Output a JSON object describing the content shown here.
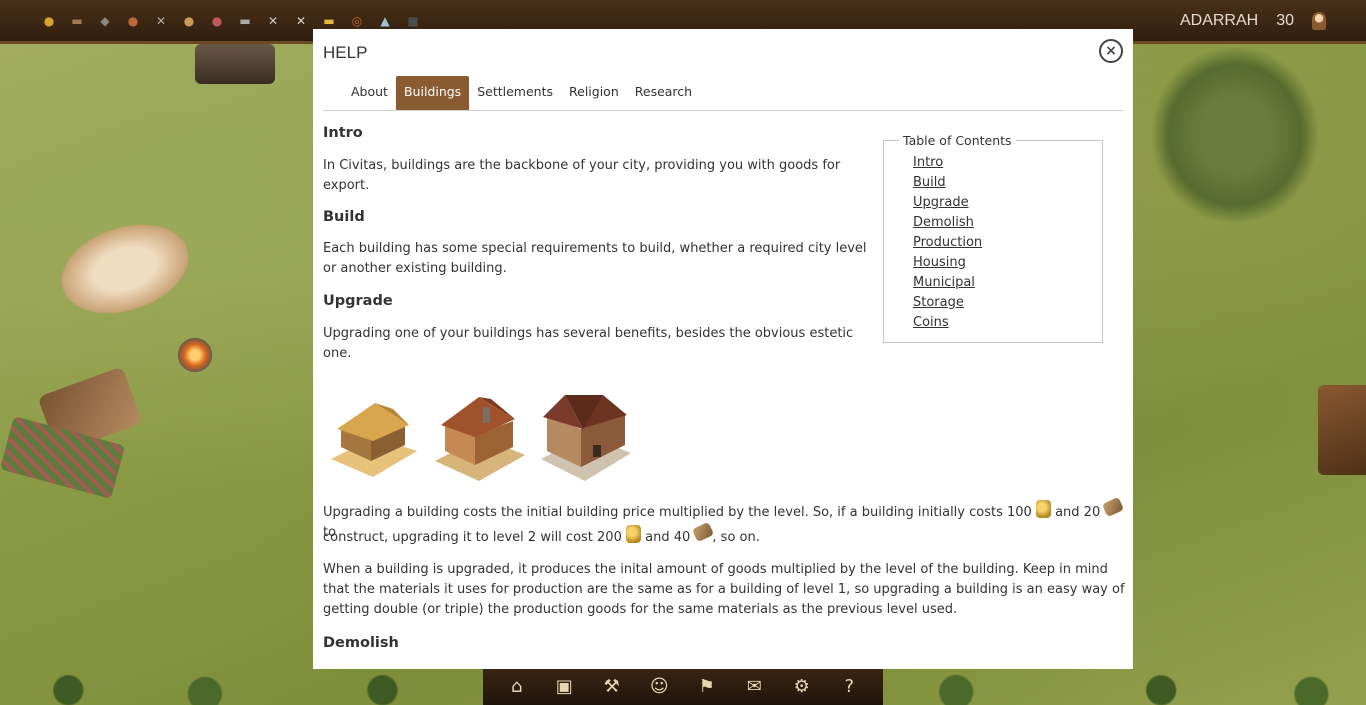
{
  "topbar": {
    "resources": [
      {
        "icon": "gold-coins-icon",
        "glyph": "●",
        "color": "#d6a62c"
      },
      {
        "icon": "wood-icon",
        "glyph": "▬",
        "color": "#a27a4f"
      },
      {
        "icon": "stone-icon",
        "glyph": "◆",
        "color": "#8a8a82"
      },
      {
        "icon": "clay-icon",
        "glyph": "●",
        "color": "#c3683b"
      },
      {
        "icon": "tools-icon",
        "glyph": "✕",
        "color": "#b0aea8"
      },
      {
        "icon": "bread-icon",
        "glyph": "●",
        "color": "#c99a58"
      },
      {
        "icon": "meat-icon",
        "glyph": "●",
        "color": "#c2575e"
      },
      {
        "icon": "cloth-icon",
        "glyph": "▬",
        "color": "#a9a9a9"
      },
      {
        "icon": "swords-icon",
        "glyph": "✕",
        "color": "#c9c9c9"
      },
      {
        "icon": "hammer-icon",
        "glyph": "✕",
        "color": "#d8d8d8"
      },
      {
        "icon": "gold-bar-icon",
        "glyph": "▬",
        "color": "#e2b935"
      },
      {
        "icon": "rope-icon",
        "glyph": "◎",
        "color": "#c36c3a"
      },
      {
        "icon": "water-icon",
        "glyph": "▲",
        "color": "#9fc2d6"
      },
      {
        "icon": "coal-icon",
        "glyph": "■",
        "color": "#4c4c4c"
      }
    ],
    "player_name": "ADARRAH",
    "player_level": "30",
    "avatar_icon": "player-avatar-icon"
  },
  "help": {
    "title": "HELP",
    "close_glyph": "×",
    "tabs": [
      "About",
      "Buildings",
      "Settlements",
      "Religion",
      "Research"
    ],
    "active_tab": "Buildings",
    "toc": {
      "title": "Table of Contents",
      "items": [
        "Intro",
        "Build",
        "Upgrade",
        "Demolish",
        "Production",
        "Housing",
        "Municipal",
        "Storage",
        "Coins"
      ]
    },
    "sections": {
      "intro_heading": "Intro",
      "intro_text": "In Civitas, buildings are the backbone of your city, providing you with goods for export.",
      "build_heading": "Build",
      "build_text": "Each building has some special requirements to build, whether a required city level or another existing building.",
      "upgrade_heading": "Upgrade",
      "upgrade_text": "Upgrading one of your buildings has several benefits, besides the obvious estetic one.",
      "cost_line1_a": "Upgrading a building costs the initial building price multiplied by the level. So, if a building initially costs 100",
      "cost_line1_b": "and 20",
      "cost_line1_c": "to",
      "cost_line2_a": "construct, upgrading it to level 2 will cost 200",
      "cost_line2_b": "and 40",
      "cost_line2_c": ", so on.",
      "production_text": "When a building is upgraded, it produces the inital amount of goods multiplied by the level of the building. Keep in mind that the materials it uses for production are the same as for a building of level 1, so upgrading a building is an easy way of getting double (or triple) the production goods for the same materials as the previous level used.",
      "demolish_heading": "Demolish"
    },
    "building_images": [
      "building-level-1-image",
      "building-level-2-image",
      "building-level-3-image"
    ]
  },
  "bottombar": {
    "buttons": [
      {
        "icon": "house-icon",
        "glyph": "⌂"
      },
      {
        "icon": "warehouse-icon",
        "glyph": "▣"
      },
      {
        "icon": "craft-icon",
        "glyph": "⚒"
      },
      {
        "icon": "citizens-icon",
        "glyph": "☺"
      },
      {
        "icon": "banner-icon",
        "glyph": "⚑"
      },
      {
        "icon": "scroll-icon",
        "glyph": "✉"
      },
      {
        "icon": "catapult-icon",
        "glyph": "⚙"
      },
      {
        "icon": "help-icon",
        "glyph": "?"
      }
    ]
  }
}
